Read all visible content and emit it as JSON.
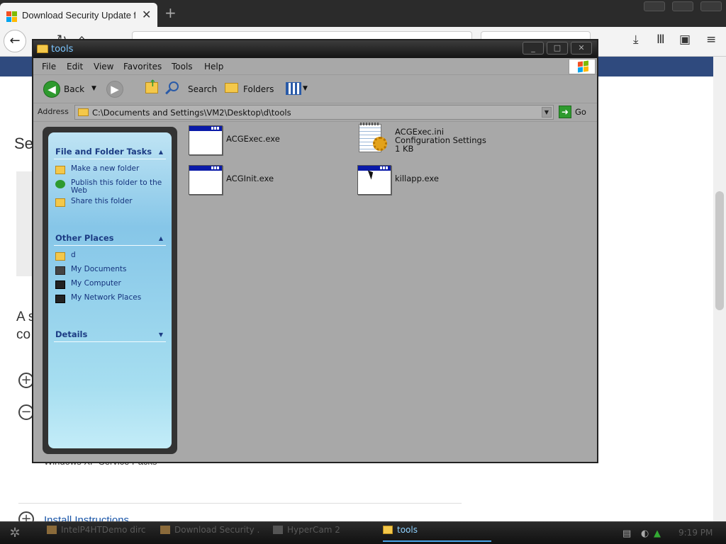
{
  "browser": {
    "tab_title": "Download Security Update for",
    "tab_close": "✕",
    "new_tab": "+",
    "nav": {
      "back": "←",
      "refresh": "↻",
      "home": "⌂",
      "download": "⤓",
      "library": "Ⅲ",
      "sidebar": "▣",
      "menu": "≡"
    },
    "page_fragments": {
      "heading": "Se",
      "para_line1": "A s",
      "para_line2": "co",
      "expand": "+",
      "collapse": "−",
      "partial_text": "Windows XP Service Packs",
      "install_link": "Install Instructions"
    }
  },
  "explorer": {
    "title": "tools",
    "controls": {
      "minimize": "_",
      "maximize": "□",
      "close": "✕"
    },
    "menu": [
      "File",
      "Edit",
      "View",
      "Favorites",
      "Tools",
      "Help"
    ],
    "toolbar": {
      "back": "Back",
      "search": "Search",
      "folders": "Folders"
    },
    "address": {
      "label": "Address",
      "path": "C:\\Documents and Settings\\VM2\\Desktop\\d\\tools",
      "go": "Go"
    },
    "task_pane": {
      "file_tasks": {
        "heading": "File and Folder Tasks",
        "items": [
          "Make a new folder",
          "Publish this folder to the Web",
          "Share this folder"
        ]
      },
      "other_places": {
        "heading": "Other Places",
        "items": [
          "d",
          "My Documents",
          "My Computer",
          "My Network Places"
        ]
      },
      "details": {
        "heading": "Details"
      }
    },
    "files": [
      {
        "name": "ACGExec.exe",
        "type": "exe"
      },
      {
        "name": "ACGExec.ini",
        "type": "ini",
        "desc": "Configuration Settings",
        "size": "1 KB"
      },
      {
        "name": "ACGInit.exe",
        "type": "exe"
      },
      {
        "name": "killapp.exe",
        "type": "exe"
      }
    ]
  },
  "taskbar": {
    "tasks": [
      "IntelP4HTDemo dirc...",
      "Download Security ...",
      "HyperCam 2",
      "tools"
    ],
    "clock": "9:19 PM"
  },
  "colors": {
    "explorer_bg": "#a8a8a8",
    "task_pane_text": "#1c3c84",
    "title_text": "#7cc6ff",
    "browser_header": "#2f4a7e"
  }
}
